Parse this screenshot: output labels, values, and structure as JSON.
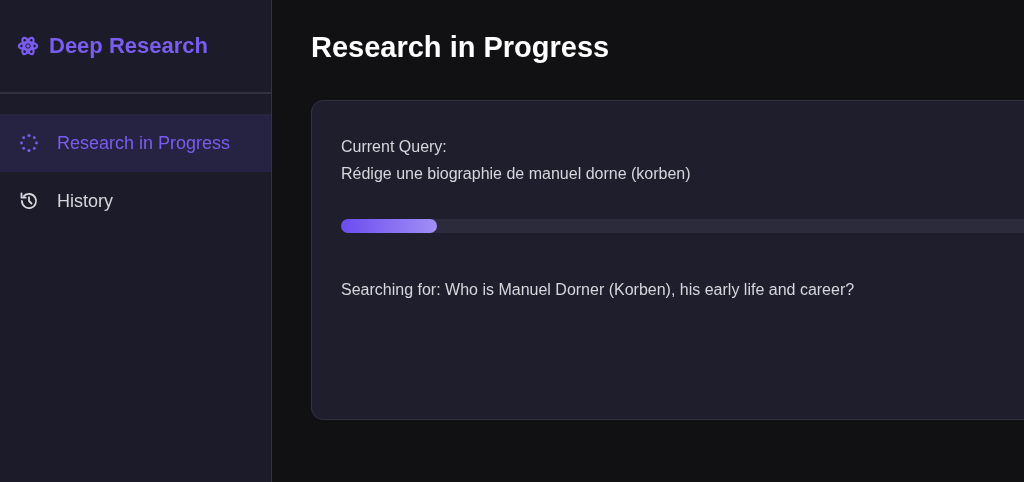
{
  "sidebar": {
    "title": "Deep Research",
    "items": [
      {
        "label": "Research in Progress",
        "kind": "progress",
        "selected": true
      },
      {
        "label": "History",
        "kind": "history",
        "selected": false
      }
    ]
  },
  "main": {
    "title": "Research in Progress",
    "card": {
      "query_label": "Current Query:",
      "query": "Rédige une biographie de manuel dorne (korben)",
      "progress": {
        "level": 0.13
      },
      "status": "Searching for: Who is Manuel Dorner (Korben), his early life and career?"
    }
  }
}
